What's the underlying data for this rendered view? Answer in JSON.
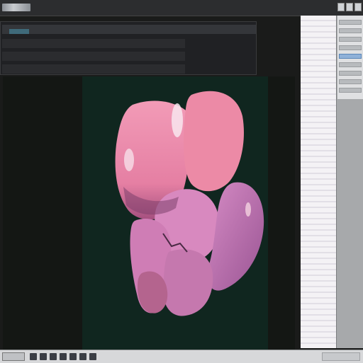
{
  "window": {
    "title": "",
    "controls": [
      "minimize-icon",
      "maximize-icon",
      "close-icon"
    ]
  },
  "info_panel": {
    "lines": [
      "",
      "",
      "",
      ""
    ]
  },
  "viewport": {
    "content": "3d-organ-render",
    "colors": {
      "background": "#10261f",
      "upper_lobe": "#e97fa2",
      "lower_lobe": "#c57ab6",
      "shadow": "#8a4f86"
    }
  },
  "properties_panel": {
    "selected_row": 4
  },
  "taskbar": {
    "icons": [
      "start-icon",
      "app-icon",
      "app-icon",
      "app-icon",
      "app-icon",
      "app-icon",
      "app-icon",
      "app-icon"
    ]
  }
}
